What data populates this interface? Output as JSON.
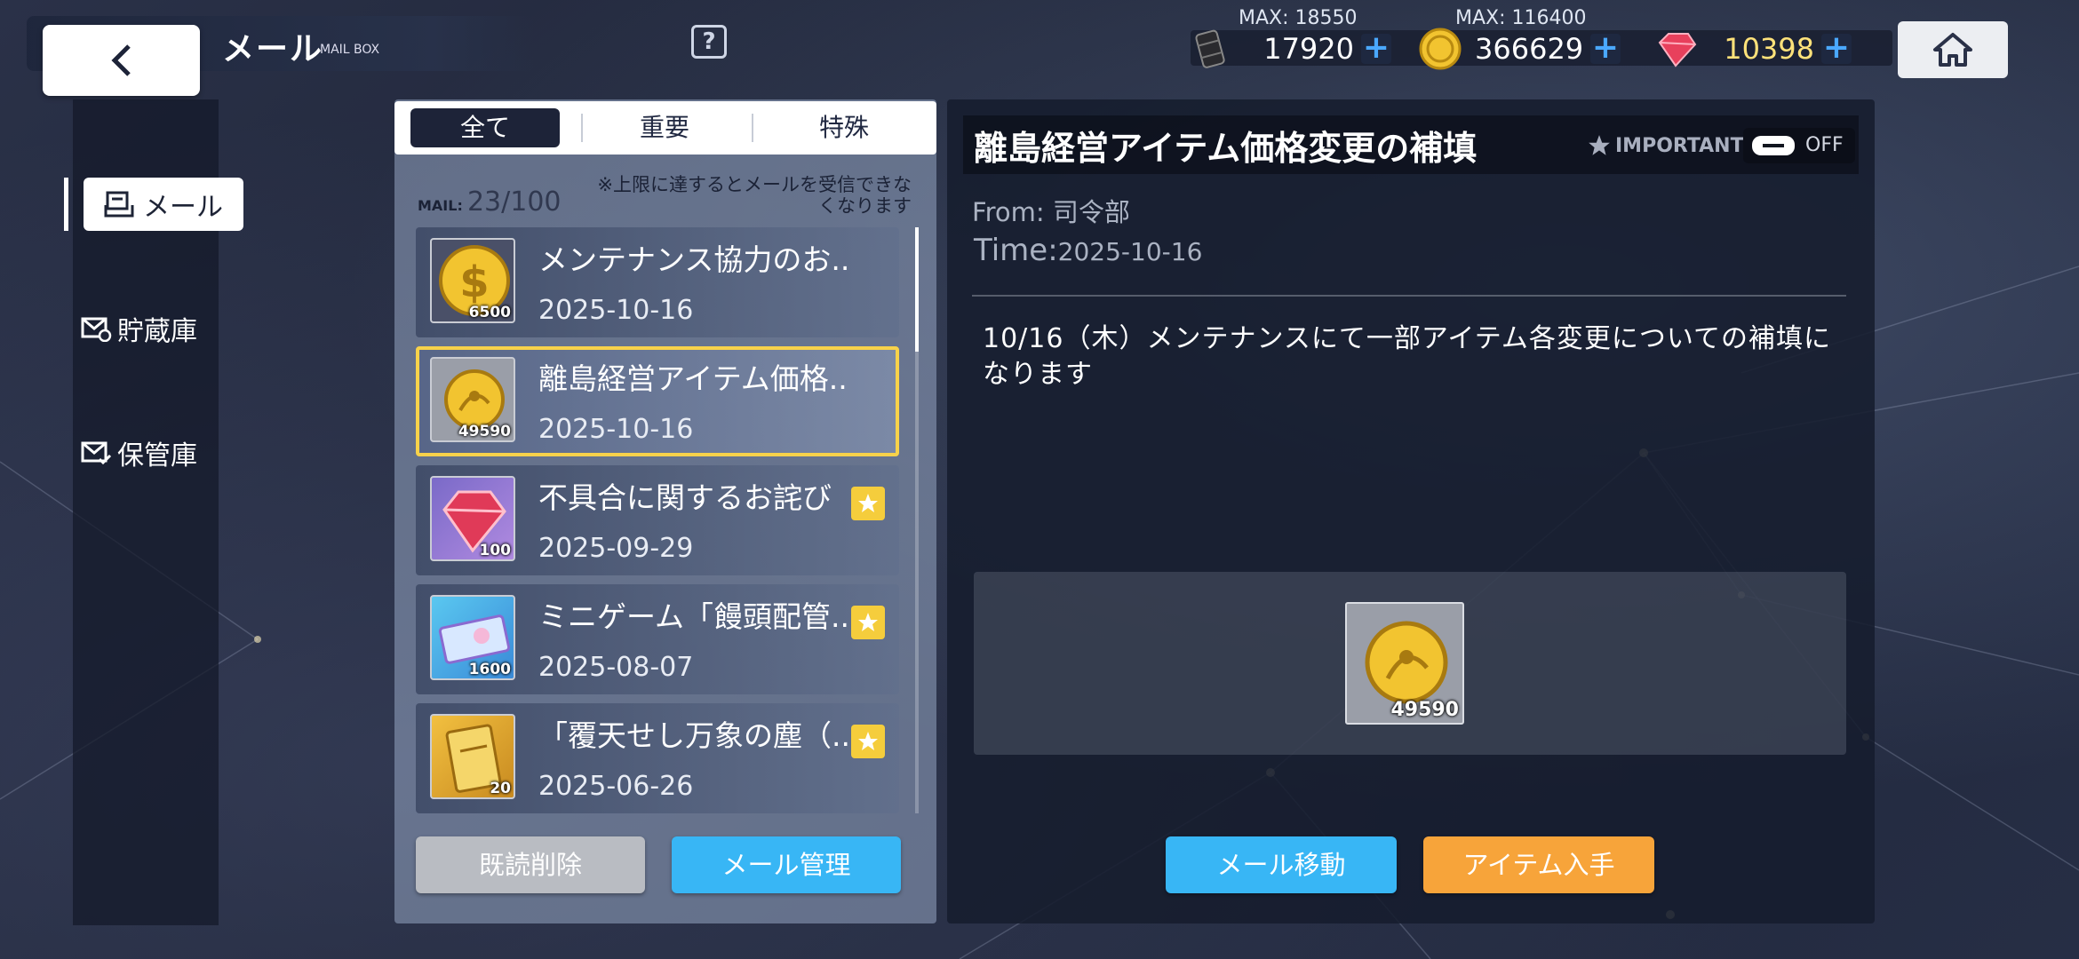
{
  "header": {
    "title": "メール",
    "subtitle": "MAIL BOX",
    "help_label": "?"
  },
  "currency": {
    "fuel": {
      "max_label": "MAX: 18550",
      "value": "17920",
      "icon": "fuel-barrel-icon"
    },
    "coins": {
      "max_label": "MAX: 116400",
      "value": "366629",
      "icon": "coin-icon"
    },
    "gems": {
      "value": "10398",
      "icon": "gem-icon",
      "color": "#ffe27a"
    },
    "plus_label": "+"
  },
  "sidebar": {
    "items": [
      {
        "label": "メール",
        "icon": "mail-icon",
        "active": true
      },
      {
        "label": "貯蔵庫",
        "icon": "storage-mail-icon",
        "active": false
      },
      {
        "label": "保管庫",
        "icon": "archive-mail-icon",
        "active": false
      }
    ]
  },
  "tabs": [
    {
      "label": "全て",
      "active": true
    },
    {
      "label": "重要",
      "active": false
    },
    {
      "label": "特殊",
      "active": false
    }
  ],
  "mail_count": {
    "label": "MAIL:",
    "value": "23/100"
  },
  "mail_note": "※上限に達するとメールを受信できなくなります",
  "mails": [
    {
      "title": "メンテナンス協力のお..",
      "date": "2025-10-16",
      "qty": "6500",
      "thumb": "coin-bag-icon",
      "starred": false,
      "selected": false
    },
    {
      "title": "離島経営アイテム価格..",
      "date": "2025-10-16",
      "qty": "49590",
      "thumb": "island-coin-icon",
      "starred": false,
      "selected": true
    },
    {
      "title": "不具合に関するお詫び",
      "date": "2025-09-29",
      "qty": "100",
      "thumb": "gem-icon",
      "starred": true,
      "selected": false
    },
    {
      "title": "ミニゲーム「饅頭配管..",
      "date": "2025-08-07",
      "qty": "1600",
      "thumb": "ticket-icon",
      "starred": true,
      "selected": false
    },
    {
      "title": "「覆天せし万象の塵（..",
      "date": "2025-06-26",
      "qty": "20",
      "thumb": "gold-ticket-icon",
      "starred": true,
      "selected": false
    }
  ],
  "list_buttons": {
    "delete_read": "既読削除",
    "manage": "メール管理"
  },
  "detail": {
    "title": "離島経営アイテム価格変更の補填",
    "important_label": "IMPORTANT",
    "toggle_state": "OFF",
    "from_label": "From: 司令部",
    "time_label": "Time:",
    "time_value": "2025-10-16",
    "body": "10/16（木）メンテナンスにて一部アイテム各変更についての補填になります",
    "attachment_qty": "49590",
    "move_button": "メール移動",
    "claim_button": "アイテム入手"
  },
  "colors": {
    "accent_blue": "#38b6f5",
    "accent_orange": "#f7a43a",
    "highlight_yellow": "#f8d24a",
    "disabled_gray": "#b9bcc2"
  }
}
